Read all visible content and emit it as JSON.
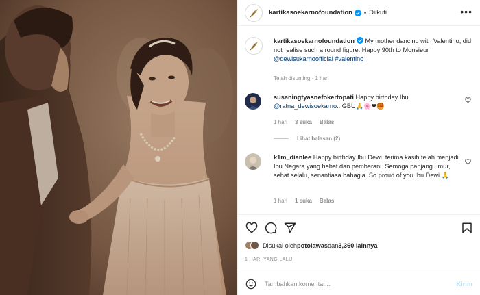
{
  "photo": {
    "alt": ""
  },
  "header": {
    "username": "kartikasoekarnofoundation",
    "separator": "•",
    "follow_label": "Diikuti",
    "more_label": "•••"
  },
  "caption": {
    "username": "kartikasoekarnofoundation",
    "text_1": " My mother dancing with Valentino, did not realise such a round figure. Happy 90th to Monsieur ",
    "mention": "@dewisukarnoofficial",
    "hashtag": "#valentino",
    "edited": "Telah disunting · 1 hari"
  },
  "comments": [
    {
      "username": "susaningtyasnefokertopati",
      "text_1": " Happy birthday Ibu ",
      "mention": "@ratna_dewisoekarno",
      "text_2": ".. GBU🙏🌸❤🥮",
      "time": "1 hari",
      "likes": "3 suka",
      "reply": "Balas",
      "view_replies": "Lihat balasan (2)"
    },
    {
      "username": "k1m_dianlee",
      "text_1": " Happy birthday Ibu Dewi, terima kasih telah menjadi Ibu Negara yang hebat dan pemberani. Semoga panjang umur, sehat selalu, senantiasa bahagia. So proud of you Ibu Dewi 🙏",
      "time": "1 hari",
      "likes": "1 suka",
      "reply": "Balas"
    }
  ],
  "likes": {
    "prefix": "Disukai oleh ",
    "user": "potolawas",
    "mid": " dan ",
    "count": "3,360 lainnya"
  },
  "posted_ago": "1 HARI YANG LALU",
  "composer": {
    "placeholder": "Tambahkan komentar...",
    "post_label": "Kirim"
  },
  "icons": [
    "heart-icon",
    "comment-icon",
    "share-icon",
    "bookmark-icon",
    "emoji-icon",
    "verified-icon",
    "more-icon"
  ],
  "colors": {
    "link": "#00376b",
    "verified": "#0095f6",
    "post_btn": "#b2dffc",
    "muted": "#8e8e8e"
  }
}
